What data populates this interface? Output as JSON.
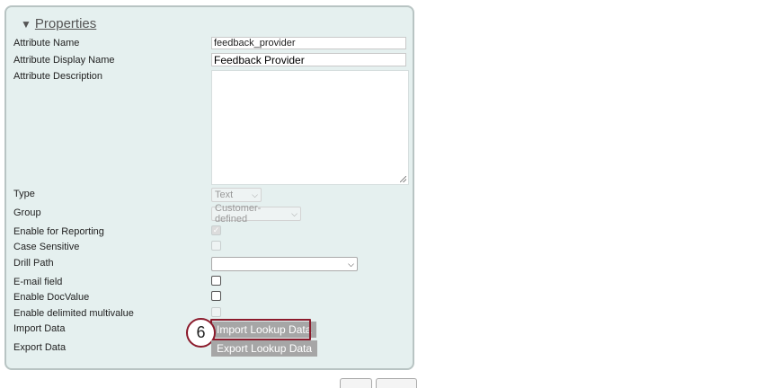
{
  "section": {
    "toggle_glyph": "▼",
    "title": "Properties"
  },
  "fields": {
    "attribute_name": {
      "label": "Attribute Name",
      "value": "feedback_provider"
    },
    "attribute_display_name": {
      "label": "Attribute Display Name",
      "value": "Feedback Provider"
    },
    "attribute_description": {
      "label": "Attribute Description",
      "value": ""
    },
    "type": {
      "label": "Type",
      "selected": "Text"
    },
    "group": {
      "label": "Group",
      "selected": "Customer-defined"
    },
    "enable_for_reporting": {
      "label": "Enable for Reporting",
      "checked": true,
      "disabled": true
    },
    "case_sensitive": {
      "label": "Case Sensitive",
      "checked": false,
      "disabled": true
    },
    "drill_path": {
      "label": "Drill Path",
      "selected": ""
    },
    "email_field": {
      "label": "E-mail field",
      "checked": false
    },
    "enable_docvalue": {
      "label": "Enable DocValue",
      "checked": false
    },
    "enable_delimited_multivalue": {
      "label": "Enable delimited multivalue",
      "checked": false,
      "disabled": true
    },
    "import_data": {
      "label": "Import Data",
      "button_label": "Import Lookup Data"
    },
    "export_data": {
      "label": "Export Data",
      "button_label": "Export Lookup Data"
    }
  },
  "annotation": {
    "step_number": "6",
    "color": "#8b1a2b"
  },
  "icons": {
    "chevron": "chevron-down-icon",
    "check": "check-icon",
    "resize": "resize-grip-icon"
  }
}
